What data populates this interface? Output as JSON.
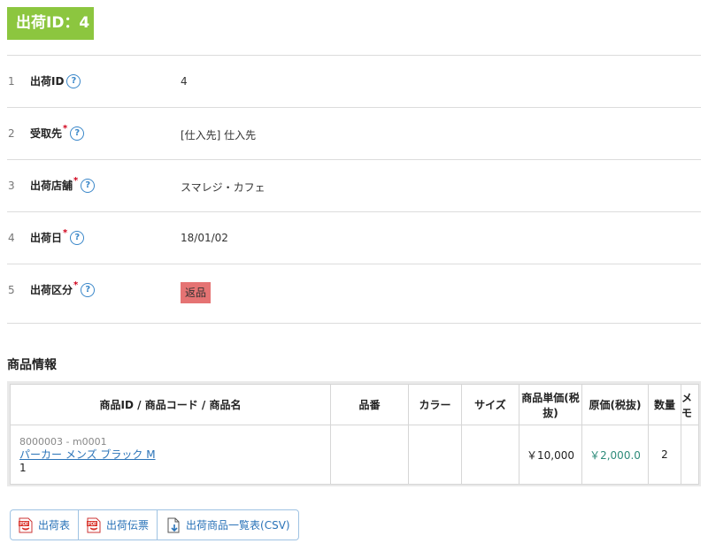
{
  "page_title": "出荷ID：4",
  "fields": [
    {
      "num": "1",
      "label": "出荷ID",
      "required": "",
      "value": "4"
    },
    {
      "num": "2",
      "label": "受取先",
      "required": "*",
      "value": "[仕入先] 仕入先"
    },
    {
      "num": "3",
      "label": "出荷店舗",
      "required": "*",
      "value": "スマレジ・カフェ"
    },
    {
      "num": "4",
      "label": "出荷日",
      "required": "*",
      "value": "18/01/02"
    },
    {
      "num": "5",
      "label": "出荷区分",
      "required": "*",
      "value": "返品"
    }
  ],
  "help_icon": "question-circle-icon",
  "section_title": "商品情報",
  "table": {
    "headers": [
      "商品ID / 商品コード / 商品名",
      "品番",
      "カラー",
      "サイズ",
      "商品単価(税抜)",
      "原価(税抜)",
      "数量",
      "メモ"
    ],
    "rows": [
      {
        "code": "8000003 - m0001",
        "name": "パーカー メンズ ブラック M",
        "sub": "1",
        "part_no": "",
        "color": "",
        "size": "",
        "unit_price": "￥10,000",
        "cost": "￥2,000.0",
        "qty": "2",
        "memo": ""
      }
    ]
  },
  "buttons": [
    {
      "label": "出荷表",
      "icon": "pdf-icon"
    },
    {
      "label": "出荷伝票",
      "icon": "pdf-icon"
    },
    {
      "label": "出荷商品一覧表(CSV)",
      "icon": "csv-download-icon"
    }
  ],
  "colors": {
    "title_bg": "#8cc63f",
    "badge_bg": "#e57373",
    "link": "#2a73b8",
    "required": "#d0021b",
    "cost": "#2e8b7a"
  }
}
